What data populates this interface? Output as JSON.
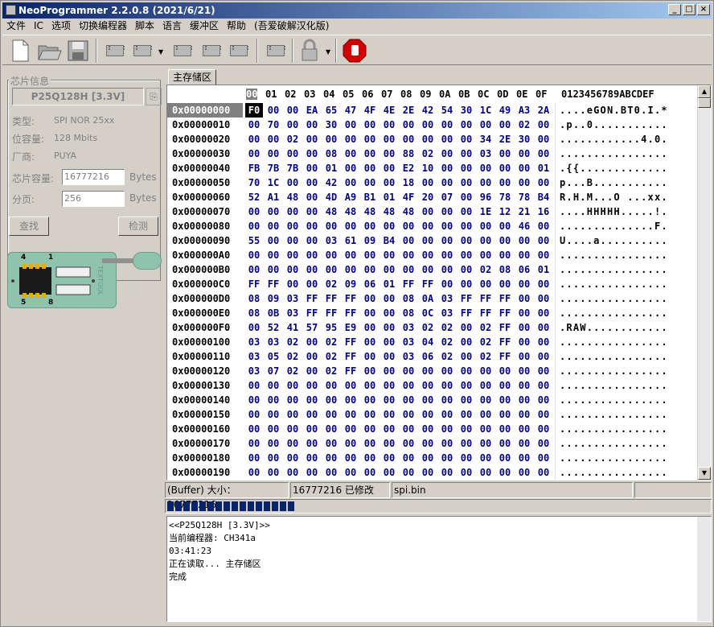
{
  "window": {
    "title": "NeoProgrammer 2.2.0.8 (2021/6/21)",
    "controls": [
      "_",
      "□",
      "×"
    ]
  },
  "menu": [
    "文件",
    "IC",
    "选项",
    "切换编程器",
    "脚本",
    "语言",
    "缓冲区",
    "帮助",
    "(吾爱破解汉化版)"
  ],
  "toolbar": {
    "icons": [
      "new-file-icon",
      "open-file-icon",
      "save-icon",
      "read-chip-icon",
      "write-chip-icon",
      "erase-chip-icon",
      "verify-chip-icon",
      "blank-check-icon",
      "auto-detect-icon",
      "lock-icon",
      "stop-icon"
    ]
  },
  "chip_info": {
    "group_title": "芯片信息",
    "chip_name": "P25Q128H [3.3V]",
    "type_label": "类型:",
    "type_value": "SPI NOR 25xx",
    "capacity_label": "位容量:",
    "capacity_value": "128 Mbits",
    "vendor_label": "厂商:",
    "vendor_value": "PUYA",
    "size_label": "芯片容量:",
    "size_value": "16777216",
    "size_unit": "Bytes",
    "page_label": "分页:",
    "page_value": "256",
    "page_unit": "Bytes",
    "find_button": "查找",
    "detect_button": "检测"
  },
  "board": {
    "pin_top_left": "4",
    "pin_top_right": "1",
    "pin_bottom_left": "5",
    "pin_bottom_right": "8",
    "brand": "TEXTOOL"
  },
  "buffer_tab": "主存储区",
  "hex": {
    "header_cols": [
      "00",
      "01",
      "02",
      "03",
      "04",
      "05",
      "06",
      "07",
      "08",
      "09",
      "0A",
      "0B",
      "0C",
      "0D",
      "0E",
      "0F"
    ],
    "ascii_header": "0123456789ABCDEF",
    "rows": [
      {
        "addr": "0x00000000",
        "bytes": [
          "F0",
          "00",
          "00",
          "EA",
          "65",
          "47",
          "4F",
          "4E",
          "2E",
          "42",
          "54",
          "30",
          "1C",
          "49",
          "A3",
          "2A"
        ],
        "ascii": "....eGON.BT0.I.*"
      },
      {
        "addr": "0x00000010",
        "bytes": [
          "00",
          "70",
          "00",
          "00",
          "30",
          "00",
          "00",
          "00",
          "00",
          "00",
          "00",
          "00",
          "00",
          "00",
          "02",
          "00"
        ],
        "ascii": ".p..0..........."
      },
      {
        "addr": "0x00000020",
        "bytes": [
          "00",
          "00",
          "02",
          "00",
          "00",
          "00",
          "00",
          "00",
          "00",
          "00",
          "00",
          "00",
          "34",
          "2E",
          "30",
          "00"
        ],
        "ascii": "............4.0."
      },
      {
        "addr": "0x00000030",
        "bytes": [
          "00",
          "00",
          "00",
          "00",
          "08",
          "00",
          "00",
          "00",
          "88",
          "02",
          "00",
          "00",
          "03",
          "00",
          "00",
          "00"
        ],
        "ascii": "................"
      },
      {
        "addr": "0x00000040",
        "bytes": [
          "FB",
          "7B",
          "7B",
          "00",
          "01",
          "00",
          "00",
          "00",
          "E2",
          "10",
          "00",
          "00",
          "00",
          "00",
          "00",
          "01"
        ],
        "ascii": ".{{............."
      },
      {
        "addr": "0x00000050",
        "bytes": [
          "70",
          "1C",
          "00",
          "00",
          "42",
          "00",
          "00",
          "00",
          "18",
          "00",
          "00",
          "00",
          "00",
          "00",
          "00",
          "00"
        ],
        "ascii": "p...B..........."
      },
      {
        "addr": "0x00000060",
        "bytes": [
          "52",
          "A1",
          "48",
          "00",
          "4D",
          "A9",
          "B1",
          "01",
          "4F",
          "20",
          "07",
          "00",
          "96",
          "78",
          "78",
          "B4"
        ],
        "ascii": "R.H.M...O ...xx."
      },
      {
        "addr": "0x00000070",
        "bytes": [
          "00",
          "00",
          "00",
          "00",
          "48",
          "48",
          "48",
          "48",
          "48",
          "00",
          "00",
          "00",
          "1E",
          "12",
          "21",
          "16"
        ],
        "ascii": "....HHHHH.....!."
      },
      {
        "addr": "0x00000080",
        "bytes": [
          "00",
          "00",
          "00",
          "00",
          "00",
          "00",
          "00",
          "00",
          "00",
          "00",
          "00",
          "00",
          "00",
          "00",
          "46",
          "00"
        ],
        "ascii": "..............F."
      },
      {
        "addr": "0x00000090",
        "bytes": [
          "55",
          "00",
          "00",
          "00",
          "03",
          "61",
          "09",
          "B4",
          "00",
          "00",
          "00",
          "00",
          "00",
          "00",
          "00",
          "00"
        ],
        "ascii": "U....a.........."
      },
      {
        "addr": "0x000000A0",
        "bytes": [
          "00",
          "00",
          "00",
          "00",
          "00",
          "00",
          "00",
          "00",
          "00",
          "00",
          "00",
          "00",
          "00",
          "00",
          "00",
          "00"
        ],
        "ascii": "................"
      },
      {
        "addr": "0x000000B0",
        "bytes": [
          "00",
          "00",
          "00",
          "00",
          "00",
          "00",
          "00",
          "00",
          "00",
          "00",
          "00",
          "00",
          "02",
          "08",
          "06",
          "01"
        ],
        "ascii": "................"
      },
      {
        "addr": "0x000000C0",
        "bytes": [
          "FF",
          "FF",
          "00",
          "00",
          "02",
          "09",
          "06",
          "01",
          "FF",
          "FF",
          "00",
          "00",
          "00",
          "00",
          "00",
          "00"
        ],
        "ascii": "................"
      },
      {
        "addr": "0x000000D0",
        "bytes": [
          "08",
          "09",
          "03",
          "FF",
          "FF",
          "FF",
          "00",
          "00",
          "08",
          "0A",
          "03",
          "FF",
          "FF",
          "FF",
          "00",
          "00"
        ],
        "ascii": "................"
      },
      {
        "addr": "0x000000E0",
        "bytes": [
          "08",
          "0B",
          "03",
          "FF",
          "FF",
          "FF",
          "00",
          "00",
          "08",
          "0C",
          "03",
          "FF",
          "FF",
          "FF",
          "00",
          "00"
        ],
        "ascii": "................"
      },
      {
        "addr": "0x000000F0",
        "bytes": [
          "00",
          "52",
          "41",
          "57",
          "95",
          "E9",
          "00",
          "00",
          "03",
          "02",
          "02",
          "00",
          "02",
          "FF",
          "00",
          "00"
        ],
        "ascii": ".RAW............"
      },
      {
        "addr": "0x00000100",
        "bytes": [
          "03",
          "03",
          "02",
          "00",
          "02",
          "FF",
          "00",
          "00",
          "03",
          "04",
          "02",
          "00",
          "02",
          "FF",
          "00",
          "00"
        ],
        "ascii": "................"
      },
      {
        "addr": "0x00000110",
        "bytes": [
          "03",
          "05",
          "02",
          "00",
          "02",
          "FF",
          "00",
          "00",
          "03",
          "06",
          "02",
          "00",
          "02",
          "FF",
          "00",
          "00"
        ],
        "ascii": "................"
      },
      {
        "addr": "0x00000120",
        "bytes": [
          "03",
          "07",
          "02",
          "00",
          "02",
          "FF",
          "00",
          "00",
          "00",
          "00",
          "00",
          "00",
          "00",
          "00",
          "00",
          "00"
        ],
        "ascii": "................"
      },
      {
        "addr": "0x00000130",
        "bytes": [
          "00",
          "00",
          "00",
          "00",
          "00",
          "00",
          "00",
          "00",
          "00",
          "00",
          "00",
          "00",
          "00",
          "00",
          "00",
          "00"
        ],
        "ascii": "................"
      },
      {
        "addr": "0x00000140",
        "bytes": [
          "00",
          "00",
          "00",
          "00",
          "00",
          "00",
          "00",
          "00",
          "00",
          "00",
          "00",
          "00",
          "00",
          "00",
          "00",
          "00"
        ],
        "ascii": "................"
      },
      {
        "addr": "0x00000150",
        "bytes": [
          "00",
          "00",
          "00",
          "00",
          "00",
          "00",
          "00",
          "00",
          "00",
          "00",
          "00",
          "00",
          "00",
          "00",
          "00",
          "00"
        ],
        "ascii": "................"
      },
      {
        "addr": "0x00000160",
        "bytes": [
          "00",
          "00",
          "00",
          "00",
          "00",
          "00",
          "00",
          "00",
          "00",
          "00",
          "00",
          "00",
          "00",
          "00",
          "00",
          "00"
        ],
        "ascii": "................"
      },
      {
        "addr": "0x00000170",
        "bytes": [
          "00",
          "00",
          "00",
          "00",
          "00",
          "00",
          "00",
          "00",
          "00",
          "00",
          "00",
          "00",
          "00",
          "00",
          "00",
          "00"
        ],
        "ascii": "................"
      },
      {
        "addr": "0x00000180",
        "bytes": [
          "00",
          "00",
          "00",
          "00",
          "00",
          "00",
          "00",
          "00",
          "00",
          "00",
          "00",
          "00",
          "00",
          "00",
          "00",
          "00"
        ],
        "ascii": "................"
      },
      {
        "addr": "0x00000190",
        "bytes": [
          "00",
          "00",
          "00",
          "00",
          "00",
          "00",
          "00",
          "00",
          "00",
          "00",
          "00",
          "00",
          "00",
          "00",
          "00",
          "00"
        ],
        "ascii": "................"
      }
    ]
  },
  "status": {
    "buffer_size": "(Buffer) 大小： 16777216",
    "modified": "16777216 已修改",
    "filename": "spi.bin"
  },
  "progress_fraction": 0.24,
  "log": [
    "<<P25Q128H [3.3V]>>",
    "当前编程器: CH341a",
    "03:41:23",
    "正在读取... 主存储区",
    "完成"
  ]
}
